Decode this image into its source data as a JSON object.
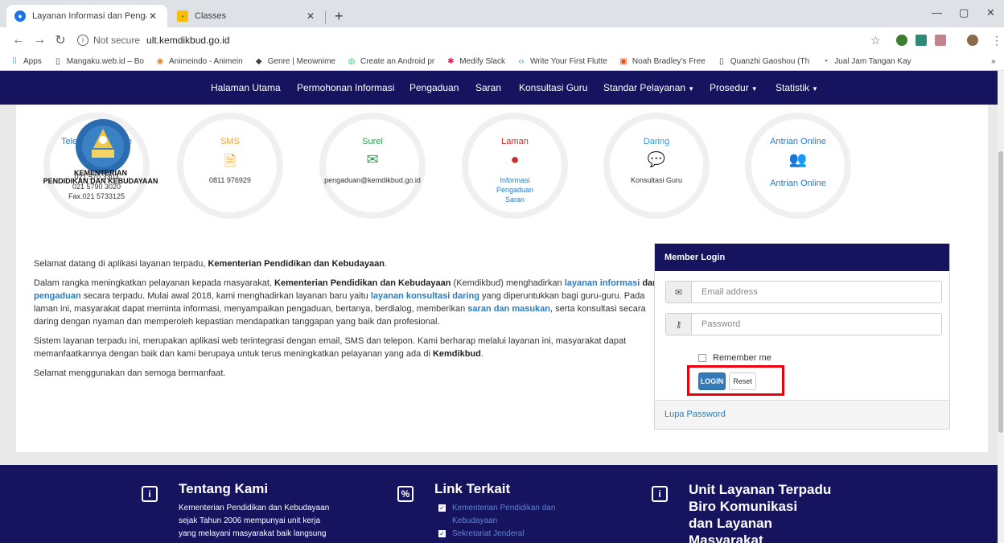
{
  "browser": {
    "tabs": [
      {
        "title": "Layanan Informasi dan Pengadu",
        "active": true
      },
      {
        "title": "Classes",
        "active": false
      }
    ],
    "new_tab": "+",
    "url_security": "Not secure",
    "url": "ult.kemdikbud.go.id",
    "bookmarks": [
      "Apps",
      "Mangaku.web.id – Bo",
      "Animeindo - Animein",
      "Genre | Meownime",
      "Create an Android pr",
      "Medify Slack",
      "Write Your First Flutte",
      "Noah Bradley's Free",
      "Quanzhi Gaoshou (Th",
      "Jual Jam Tangan Kay"
    ],
    "more": "»"
  },
  "site": {
    "nav": [
      "Halaman Utama",
      "Permohonan Informasi",
      "Pengaduan",
      "Saran",
      "Konsultasi Guru",
      "Standar Pelayanan",
      "Prosedur",
      "Statistik"
    ],
    "ministry": "KEMENTERIAN\nPENDIDIKAN DAN KEBUDAYAAN",
    "contacts": [
      {
        "title": "Telepon/Faksimile",
        "lines": [
          "021 570 3303",
          "021 5790 3020",
          "Fax.021 5733125"
        ],
        "color": "#2a7bbf"
      },
      {
        "title": "SMS",
        "lines": [
          "0811 976929"
        ],
        "color": "#f0a030"
      },
      {
        "title": "Surel",
        "lines": [
          "pengaduan@kemdikbud.go.id"
        ],
        "color": "#2e9e4f"
      },
      {
        "title": "Laman",
        "lines": [
          "Informasi",
          "Pengaduan",
          "Saran"
        ],
        "color": "#c9302c"
      },
      {
        "title": "Daring",
        "lines": [
          "Konsultasi Guru"
        ],
        "color": "#2a9fd6"
      },
      {
        "title": "Antrian Online",
        "lines": [
          "Antrian Online"
        ],
        "color": "#2a7bbf"
      }
    ],
    "intro": {
      "p1_a": "Selamat datang di aplikasi layanan terpadu, ",
      "p1_b": "Kementerian Pendidikan dan Kebudayaan",
      "p1_c": ".",
      "p2_a": "Dalam rangka meningkatkan pelayanan kepada masyarakat, ",
      "p2_b": "Kementerian Pendidikan dan Kebudayaan",
      "p2_c": " (Kemdikbud) menghadirkan ",
      "p2_d": "layanan informasi",
      "p2_e": " dan ",
      "p2_f": "pengaduan",
      "p2_g": " secara terpadu. Mulai awal 2018, kami menghadirkan layanan baru yaitu ",
      "p2_h": "layanan konsultasi daring",
      "p2_i": " yang diperuntukkan bagi guru-guru. Pada laman ini, masyarakat dapat meminta informasi, menyampaikan pengaduan, bertanya, berdialog, memberikan ",
      "p2_j": "saran dan masukan",
      "p2_k": ", serta konsultasi secara daring dengan nyaman dan memperoleh kepastian mendapatkan tanggapan yang baik dan profesional.",
      "p3_a": "Sistem layanan terpadu ini, merupakan aplikasi web terintegrasi dengan email, SMS dan telepon. Kami berharap melalui layanan ini, masyarakat dapat memanfaatkannya dengan baik dan kami berupaya untuk terus meningkatkan pelayanan yang ada di ",
      "p3_b": "Kemdikbud",
      "p3_c": ".",
      "p4": "Selamat menggunakan dan semoga bermanfaat."
    },
    "login": {
      "title": "Member Login",
      "email_placeholder": "Email address",
      "password_placeholder": "Password",
      "remember": "Remember me",
      "login_btn": "LOGIN",
      "reset_btn": "Reset",
      "forgot": "Lupa Password"
    },
    "footer": {
      "about_title": "Tentang Kami",
      "about_text": [
        "Kementerian Pendidikan dan Kebudayaan",
        "sejak Tahun 2006 mempunyai unit kerja",
        "yang melayani masyarakat baik langsung"
      ],
      "links_title": "Link Terkait",
      "links": [
        "Kementerian Pendidikan dan",
        "Kebudayaan",
        "Sekretariat Jenderal"
      ],
      "unit_lines": [
        "Unit Layanan Terpadu",
        "Biro Komunikasi",
        "dan Layanan",
        "Masyarakat"
      ]
    }
  }
}
